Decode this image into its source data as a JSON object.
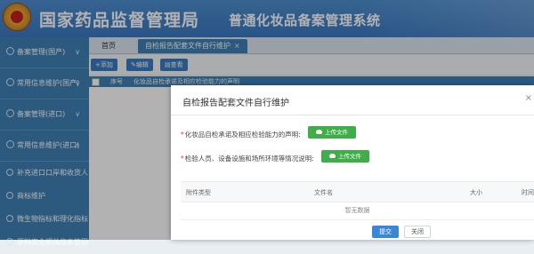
{
  "header": {
    "title_main": "国家药品监督管理局",
    "title_sub": "普通化妆品备案管理系统"
  },
  "sidebar": {
    "items": [
      {
        "label": "备案管理(国产)",
        "icon": "gear-icon"
      },
      {
        "label": "常用信息维护(国产)",
        "icon": "gear-icon"
      },
      {
        "label": "备案管理(进口)",
        "icon": "gear-icon"
      },
      {
        "label": "常用信息维护(进口)",
        "icon": "gear-icon"
      }
    ],
    "subitems": [
      {
        "label": "补充进口口岸和收货人"
      },
      {
        "label": "商标维护"
      },
      {
        "label": "微生物指标和理化指标"
      },
      {
        "label": "原料安全相关信息管理"
      }
    ]
  },
  "tabs": {
    "home": "首页",
    "active": "自检报告配套文件自行维护",
    "close": "×"
  },
  "toolbar": {
    "add": "+添加",
    "edit": "✎编辑",
    "view": "▤查看"
  },
  "grid": {
    "col_index": "序号",
    "col_name": "化妆品自检承诺及相应检验能力的声明"
  },
  "modal": {
    "title": "自检报告配套文件自行维护",
    "close": "×",
    "row1_label": "化妆品自检承诺及相应检验能力的声明:",
    "row2_label": "检验人员、设备设施和场所环境等情况说明:",
    "upload_label": "上传文件",
    "table_cols": [
      "附件类型",
      "文件名",
      "大小",
      "时间"
    ],
    "empty_text": "暂无数据",
    "submit": "提交",
    "cancel": "关闭"
  },
  "colors": {
    "accent": "#3f82b5",
    "upload_green": "#3fae49",
    "submit_blue": "#3a87d6"
  }
}
